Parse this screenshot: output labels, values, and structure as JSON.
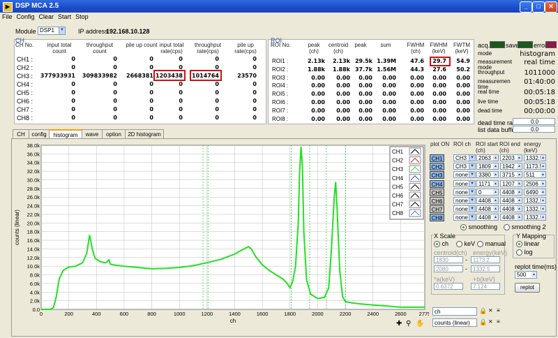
{
  "window": {
    "title": "DSP MCA 2.5"
  },
  "menu": [
    "File",
    "Config",
    "Clear",
    "Start",
    "Stop"
  ],
  "module": {
    "label": "Module",
    "value": "DSP1",
    "ip_label": "IP address",
    "ip": "192.168.10.128"
  },
  "ch_panel": {
    "title": "CH",
    "headers": [
      "CH No.",
      "input total count",
      "throughput count",
      "pile up count",
      "input total rate(cps)",
      "throughput rate(cps)",
      "pile up rate(cps)"
    ],
    "rows": [
      [
        "CH1 :",
        "0",
        "0",
        "0",
        "0",
        "0",
        "0"
      ],
      [
        "CH2 :",
        "0",
        "0",
        "0",
        "0",
        "0",
        "0"
      ],
      [
        "CH3 :",
        "377933931",
        "309833982",
        "2668381",
        "1203438",
        "1014764",
        "23570"
      ],
      [
        "CH4 :",
        "0",
        "0",
        "0",
        "0",
        "0",
        "0"
      ],
      [
        "CH5 :",
        "0",
        "0",
        "0",
        "0",
        "0",
        "0"
      ],
      [
        "CH6 :",
        "0",
        "0",
        "0",
        "0",
        "0",
        "0"
      ],
      [
        "CH7 :",
        "0",
        "0",
        "0",
        "0",
        "0",
        "0"
      ],
      [
        "CH8 :",
        "0",
        "0",
        "0",
        "0",
        "0",
        "0"
      ]
    ]
  },
  "roi_panel": {
    "title": "ROI",
    "headers": [
      "ROI No.",
      "peak (ch)",
      "centroid (ch)",
      "peak",
      "sum",
      "FWHM (ch)",
      "FWHM (keV)",
      "FWTM (keV)"
    ],
    "rows": [
      [
        "ROI1 :",
        "2.13k",
        "2.13k",
        "29.5k",
        "1.39M",
        "47.6",
        "29.7",
        "54.9"
      ],
      [
        "ROI2 :",
        "1.88k",
        "1.88k",
        "37.7k",
        "1.56M",
        "44.3",
        "27.6",
        "50.2"
      ],
      [
        "ROI3 :",
        "0.00",
        "0.00",
        "0.00",
        "0.00",
        "0.00",
        "0.00",
        "0.00"
      ],
      [
        "ROI4 :",
        "0.00",
        "0.00",
        "0.00",
        "0.00",
        "0.00",
        "0.00",
        "0.00"
      ],
      [
        "ROI5 :",
        "0.00",
        "0.00",
        "0.00",
        "0.00",
        "0.00",
        "0.00",
        "0.00"
      ],
      [
        "ROI6 :",
        "0.00",
        "0.00",
        "0.00",
        "0.00",
        "0.00",
        "0.00",
        "0.00"
      ],
      [
        "ROI7 :",
        "0.00",
        "0.00",
        "0.00",
        "0.00",
        "0.00",
        "0.00",
        "0.00"
      ],
      [
        "ROI8 :",
        "0.00",
        "0.00",
        "0.00",
        "0.00",
        "0.00",
        "0.00",
        "0.00"
      ]
    ]
  },
  "status": {
    "acq": "acq.",
    "save": "save",
    "error": "error",
    "acq_color": "#1a5a1a",
    "save_color": "#1a5a1a",
    "error_color": "#8a1a4a",
    "items": [
      {
        "label": "mode",
        "value": "histogram"
      },
      {
        "label": "measurement mode",
        "value": "real time"
      },
      {
        "label": "throughput",
        "value": "1011000"
      },
      {
        "label": "measuremen time",
        "value": "01:40:00"
      },
      {
        "label": "real time",
        "value": "00:05:18"
      },
      {
        "label": "live time",
        "value": "00:05:18"
      },
      {
        "label": "dead time",
        "value": "00:00:00"
      }
    ],
    "dead_time_ratio_label": "dead time ratio",
    "dead_time_ratio": "0.0",
    "list_buffer_label": "list data buffer",
    "list_buffer": "0.0"
  },
  "tabs": [
    "CH",
    "config",
    "histogram",
    "wave",
    "option",
    "2D histogram"
  ],
  "active_tab": 2,
  "legend": [
    "CH1",
    "CH2",
    "CH3",
    "CH4",
    "CH5",
    "CH6",
    "CH7",
    "CH8"
  ],
  "legend_colors": [
    "#000000",
    "#e02020",
    "#30d030",
    "#2040c0",
    "#000000",
    "#000000",
    "#000000",
    "#2080e0"
  ],
  "roi_table": {
    "headers": [
      "plot ON",
      "ROI ch",
      "ROI start (ch)",
      "ROI end (ch)",
      "energy (keV)"
    ],
    "rows": [
      {
        "ch": "CH1",
        "on": true,
        "roi": "CH3",
        "start": "2063",
        "end": "2203",
        "energy": "1332.5"
      },
      {
        "ch": "CH2",
        "on": true,
        "roi": "CH3",
        "start": "1809",
        "end": "1942",
        "energy": "1173.5"
      },
      {
        "ch": "CH3",
        "on": true,
        "roi": "none",
        "start": "3380",
        "end": "3715",
        "energy": "511"
      },
      {
        "ch": "CH4",
        "on": true,
        "roi": "none",
        "start": "1171",
        "end": "1207",
        "energy": "2506"
      },
      {
        "ch": "CH5",
        "on": false,
        "roi": "none",
        "start": "0",
        "end": "4408",
        "energy": "6490"
      },
      {
        "ch": "CH6",
        "on": false,
        "roi": "none",
        "start": "4408",
        "end": "4408",
        "energy": "1332.5"
      },
      {
        "ch": "CH7",
        "on": false,
        "roi": "none",
        "start": "4408",
        "end": "4408",
        "energy": "1332.5"
      },
      {
        "ch": "CH8",
        "on": true,
        "roi": "none",
        "start": "4408",
        "end": "4408",
        "energy": "1332.5"
      }
    ],
    "smoothing": "smoothing",
    "smoothing2": "smoothing 2"
  },
  "xscale": {
    "title": "X Scale",
    "opt_ch": "ch",
    "opt_kev": "keV",
    "opt_manual": "manual",
    "centroid_label": "centroid(ch)",
    "energy_label": "energy(keV)",
    "c1": "1830",
    "c2": "2080",
    "e1": "1173.2",
    "e2": "1332.5",
    "a_label": "*a(keV)",
    "b_label": "+b(keV)",
    "a": "0.6372",
    "b": "7.124"
  },
  "ymap": {
    "title": "Y Mapping",
    "linear": "linear",
    "log": "log"
  },
  "replot": {
    "label": "replot time(ms)",
    "value": "500",
    "button": "replot"
  },
  "cursor_x": {
    "value": "ch"
  },
  "cursor_y": {
    "value": "counts (linear)"
  },
  "chart_data": {
    "type": "line",
    "xlabel": "ch",
    "ylabel": "counts (linear)",
    "xlim": [
      0,
      2775
    ],
    "ylim": [
      0,
      38000
    ],
    "xticks": [
      0,
      200,
      400,
      600,
      800,
      1000,
      1200,
      1400,
      1600,
      1800,
      2000,
      2200,
      2400,
      2600,
      2775
    ],
    "yticks": [
      0,
      2000,
      4000,
      6000,
      8000,
      10000,
      12000,
      14000,
      16000,
      18000,
      20000,
      22000,
      24000,
      26000,
      28000,
      30000,
      32000,
      34000,
      36000,
      38000
    ],
    "ytick_labels": [
      "0.0",
      "2.0k",
      "4.0k",
      "6.0k",
      "8.0k",
      "10.0k",
      "12.0k",
      "14.0k",
      "16.0k",
      "18.0k",
      "20.0k",
      "22.0k",
      "24.0k",
      "26.0k",
      "28.0k",
      "30.0k",
      "32.0k",
      "34.0k",
      "36.0k",
      "38.0k"
    ],
    "roi_lines": [
      1171,
      1207,
      1809,
      1942,
      2063,
      2203
    ],
    "series": [
      {
        "x": [
          0,
          70,
          90,
          110,
          130,
          160,
          200,
          250,
          300,
          330,
          350,
          370,
          390,
          430,
          470,
          490,
          500,
          520,
          600,
          700,
          800,
          900,
          1000,
          1100,
          1200,
          1300,
          1400,
          1450,
          1480,
          1500,
          1520,
          1550,
          1600,
          1650,
          1700,
          1750,
          1780,
          1800,
          1820,
          1840,
          1860,
          1870,
          1880,
          1890,
          1900,
          1920,
          1950,
          2000,
          2050,
          2080,
          2100,
          2120,
          2130,
          2140,
          2160,
          2180,
          2200,
          2250,
          2300,
          2400,
          2500,
          2600,
          2700,
          2775
        ],
        "y": [
          0,
          0,
          500,
          3000,
          7000,
          9000,
          9800,
          10000,
          10800,
          13000,
          17200,
          14000,
          11800,
          11000,
          10800,
          11500,
          10500,
          10300,
          10000,
          9700,
          9400,
          9500,
          9700,
          10100,
          10800,
          11600,
          12800,
          13700,
          14200,
          14500,
          14000,
          12300,
          10300,
          9000,
          8000,
          7000,
          6000,
          5000,
          6500,
          10000,
          20000,
          32000,
          37700,
          33000,
          18000,
          6800,
          3500,
          2500,
          2800,
          5000,
          14000,
          26000,
          29500,
          24000,
          9000,
          3000,
          1800,
          1500,
          1300,
          1000,
          800,
          500,
          500,
          500
        ],
        "color": "#22e022"
      }
    ]
  }
}
